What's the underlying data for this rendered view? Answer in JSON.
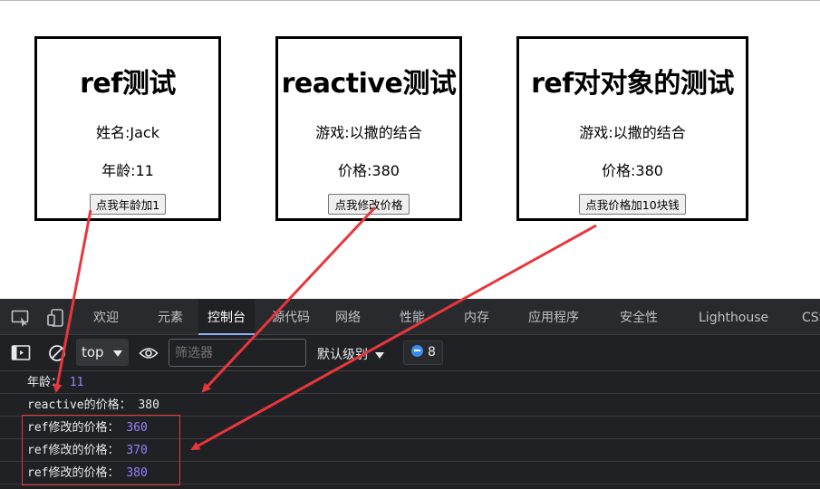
{
  "cards": [
    {
      "title": "ref测试",
      "line1": "姓名:Jack",
      "line2": "年龄:11",
      "button": "点我年龄加1"
    },
    {
      "title": "reactive测试",
      "line1": "游戏:以撒的结合",
      "line2": "价格:380",
      "button": "点我修改价格"
    },
    {
      "title": "ref对对象的测试",
      "line1": "游戏:以撒的结合",
      "line2": "价格:380",
      "button": "点我价格加10块钱"
    }
  ],
  "devtools": {
    "tabs": [
      "欢迎",
      "元素",
      "控制台",
      "源代码",
      "网络",
      "性能",
      "内存",
      "应用程序",
      "安全性",
      "Lighthouse",
      "CSS"
    ],
    "active_tab": "控制台",
    "context": "top",
    "filter_placeholder": "筛选器",
    "levels": "默认级别",
    "issues_count": "8",
    "logs": [
      {
        "label": "年龄：",
        "value": "11"
      },
      {
        "label": "reactive的价格：",
        "value": "380"
      },
      {
        "label": "ref修改的价格：",
        "value": "360"
      },
      {
        "label": "ref修改的价格：",
        "value": "370"
      },
      {
        "label": "ref修改的价格：",
        "value": "380"
      }
    ]
  },
  "colors": {
    "annotation": "#e8363d",
    "devtools_bg": "#202124",
    "number": "#9980ff",
    "active_tab_underline": "#8ab4f8"
  }
}
